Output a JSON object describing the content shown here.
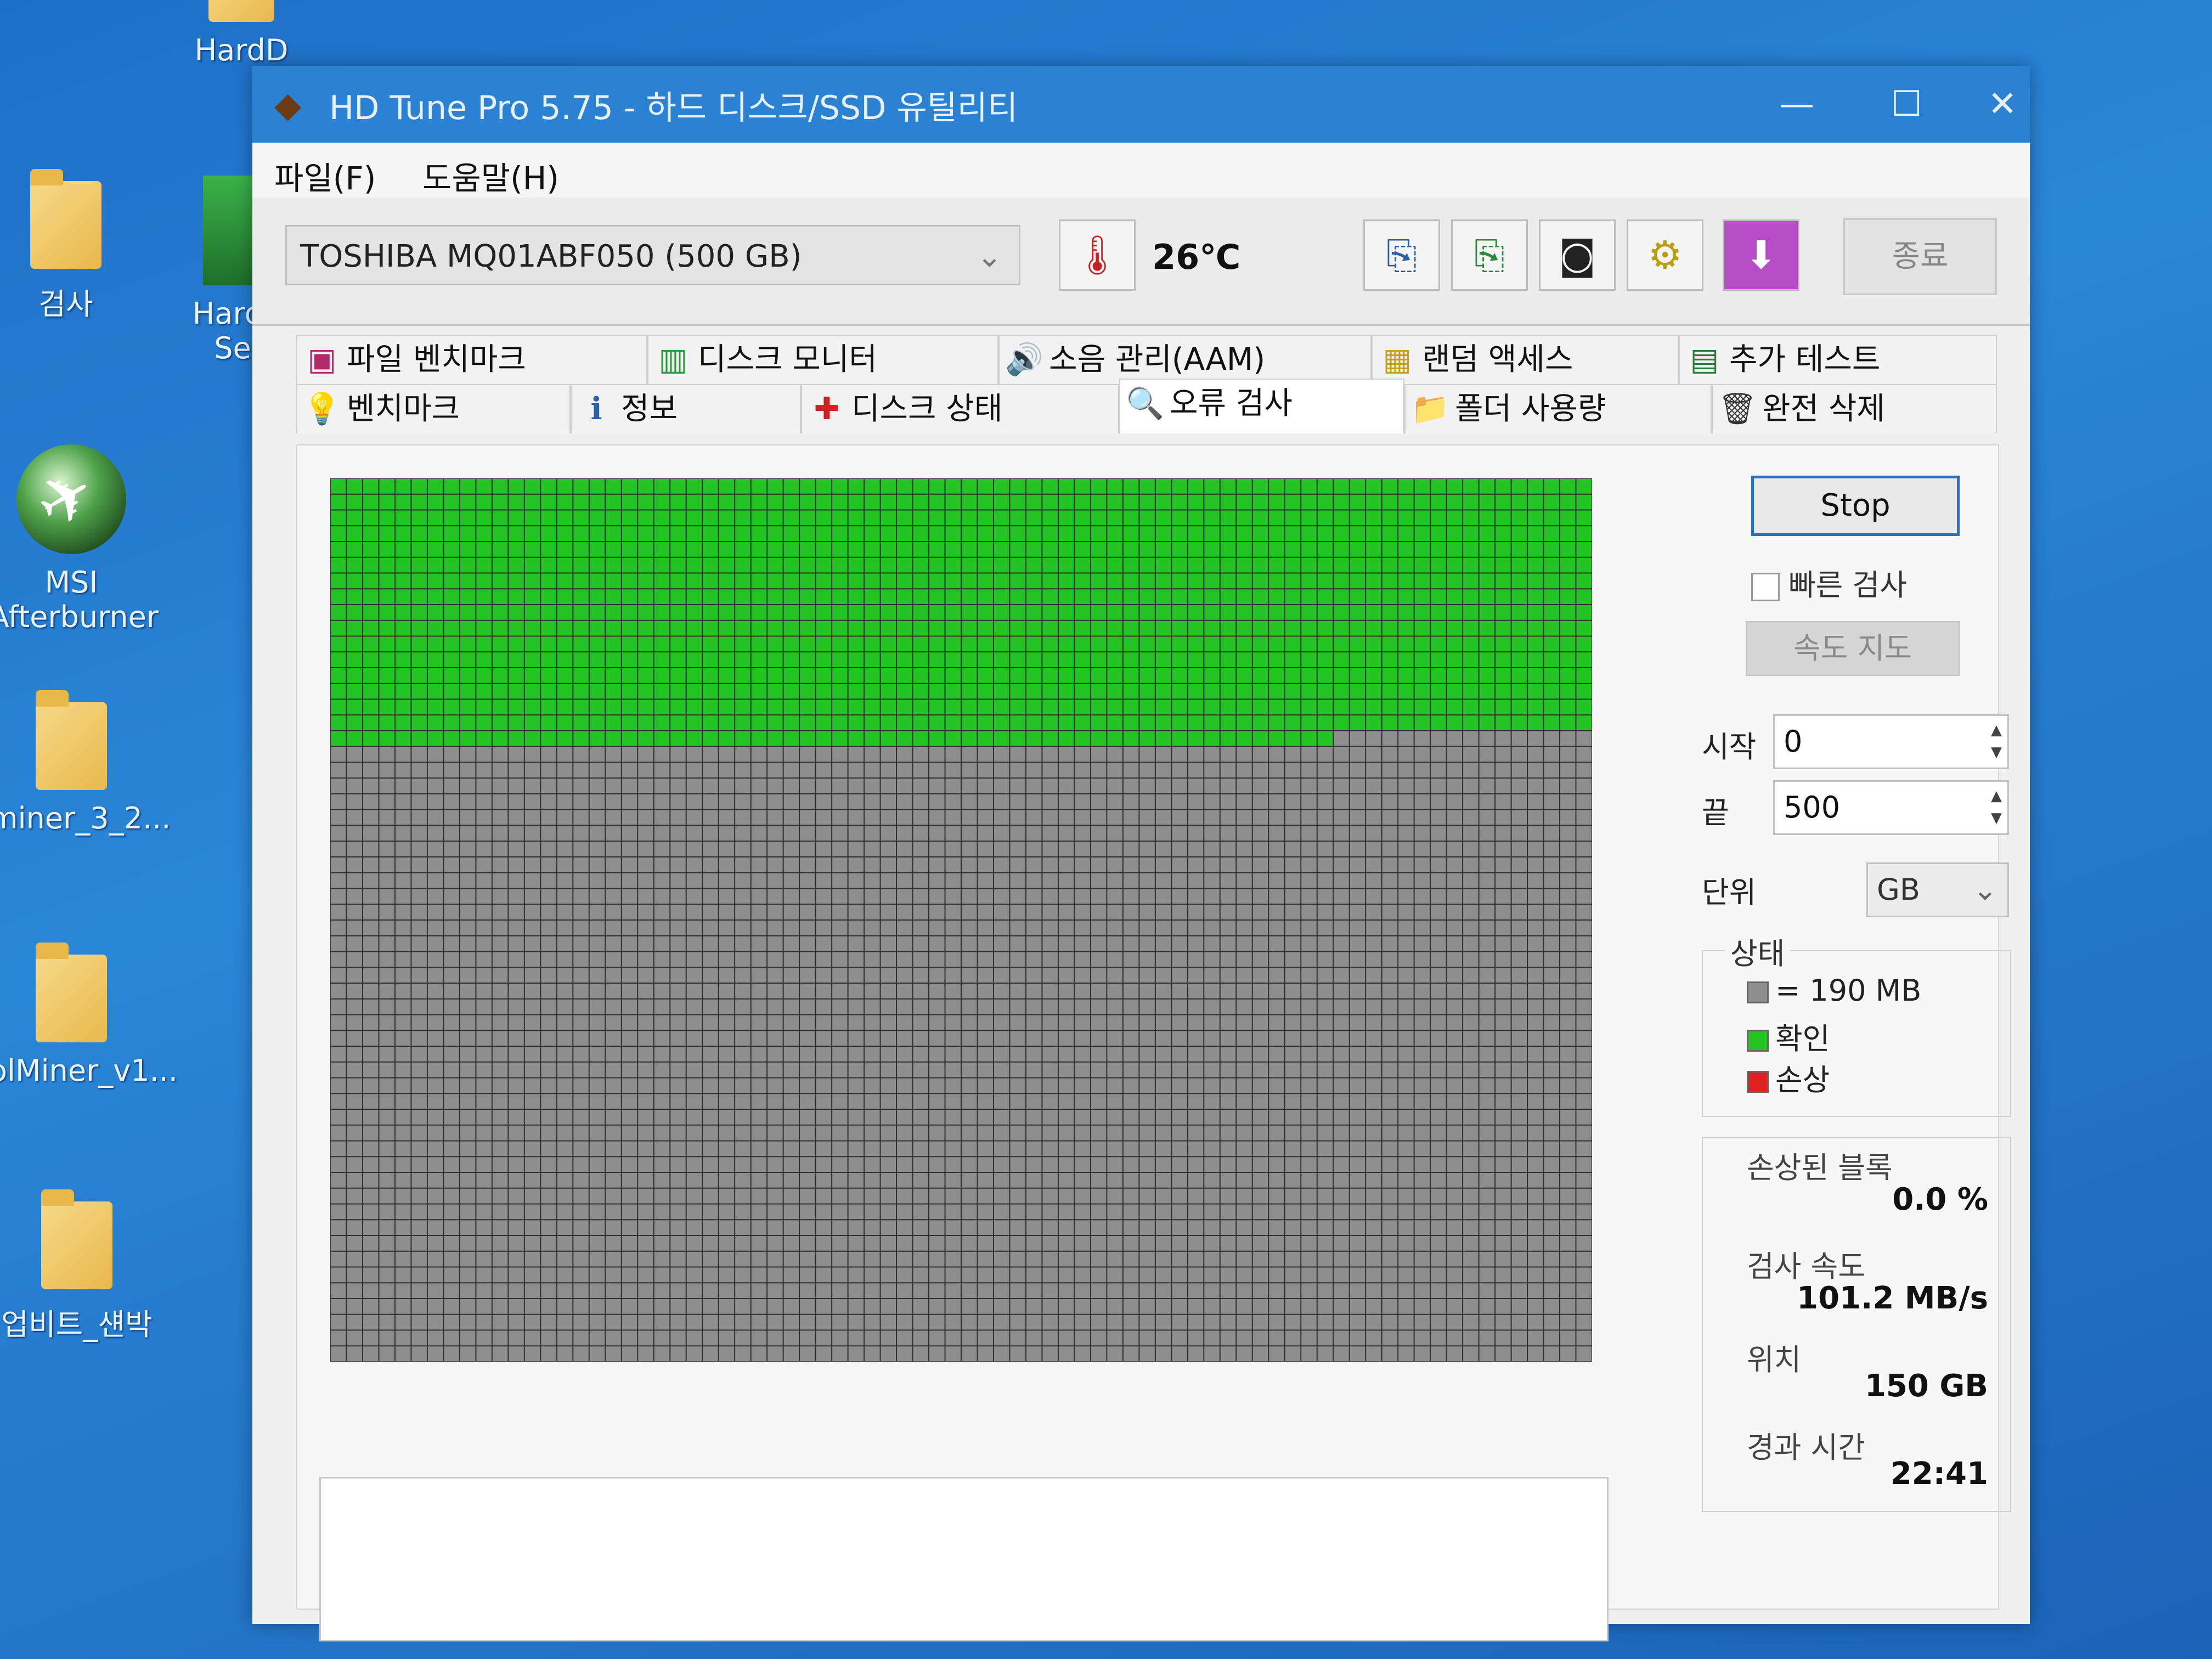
{
  "desktop": {
    "icons": [
      {
        "label": "HardD"
      },
      {
        "label": "검사"
      },
      {
        "label": "Hard"
      },
      {
        "label": "Ser"
      },
      {
        "label": "MSI"
      },
      {
        "label": "Afterburner"
      },
      {
        "label": "miner_3_2..."
      },
      {
        "label": "olMiner_v1..."
      },
      {
        "label": "업비트_섄박"
      }
    ]
  },
  "window": {
    "title": "HD Tune Pro 5.75 - 하드 디스크/SSD 유틸리티",
    "controls": {
      "minimize": "—",
      "maximize": "☐",
      "close": "✕"
    }
  },
  "menu": {
    "file": "파일(F)",
    "help": "도움말(H)"
  },
  "toolbar": {
    "drive": "TOSHIBA MQ01ABF050 (500 GB)",
    "temperature": "26℃",
    "exit_label": "종료",
    "icons": [
      "thermometer-icon",
      "copy-text-icon",
      "copy-screen-icon",
      "camera-icon",
      "options-icon",
      "download-icon"
    ]
  },
  "tabs": {
    "row1": [
      "파일 벤치마크",
      "디스크 모니터",
      "소음 관리(AAM)",
      "랜덤 액세스",
      "추가 테스트"
    ],
    "row2": [
      "벤치마크",
      "정보",
      "디스크 상태",
      "오류 검사",
      "폴더 사용량",
      "완전 삭제"
    ],
    "active": "오류 검사"
  },
  "error_scan": {
    "stop_label": "Stop",
    "quick_scan_label": "빠른 검사",
    "quick_scan_checked": false,
    "speed_map_label": "속도 지도",
    "start_label": "시작",
    "start_value": "0",
    "end_label": "끝",
    "end_value": "500",
    "unit_label": "단위",
    "unit_value": "GB",
    "legend": {
      "title": "상태",
      "block_size": "= 190 MB",
      "ok_label": "확인",
      "damaged_label": "손상"
    },
    "stats": {
      "damaged_blocks_label": "손상된 블록",
      "damaged_blocks_value": "0.0 %",
      "scan_speed_label": "검사 속도",
      "scan_speed_value": "101.2 MB/s",
      "position_label": "위치",
      "position_value": "150 GB",
      "elapsed_label": "경과 시간",
      "elapsed_value": "22:41"
    },
    "grid": {
      "columns": 78,
      "rows": 56,
      "checked_fraction": 0.3
    },
    "colors": {
      "ok": "#25c425",
      "untested": "#8e8e8e",
      "damaged": "#e02020",
      "grid_line": "#2b2b2b"
    }
  }
}
